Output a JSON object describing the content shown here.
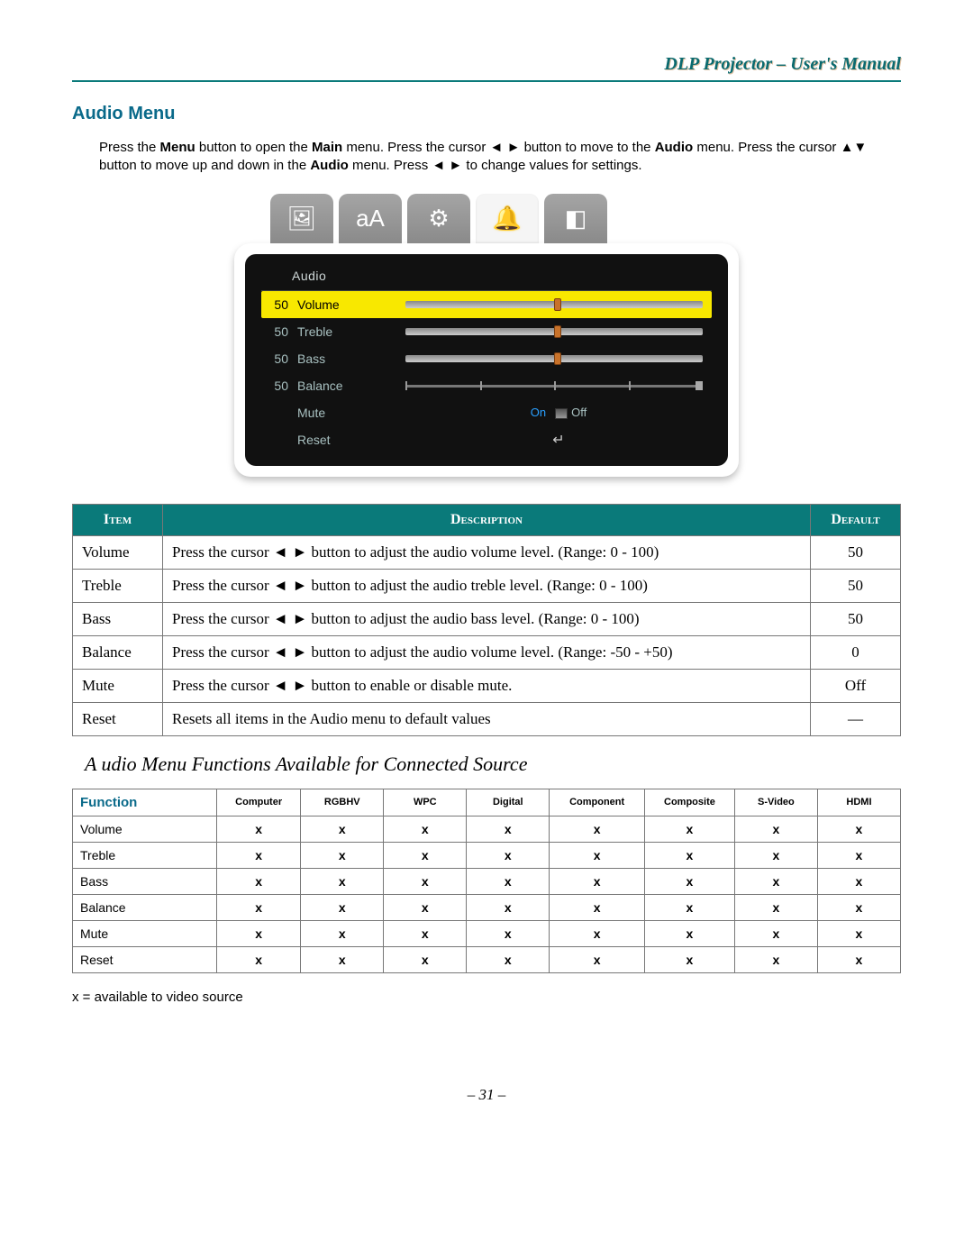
{
  "header": {
    "title": "DLP Projector – User's Manual"
  },
  "section": {
    "title": "Audio Menu"
  },
  "intro": {
    "parts": [
      "Press the ",
      "Menu",
      " button to open the ",
      "Main",
      " menu. Press the cursor ◄ ► button to move to the ",
      "Audio",
      " menu. Press the cursor ▲▼ button to move up and down in the ",
      "Audio",
      " menu. Press ◄ ► to change values for settings."
    ]
  },
  "osd": {
    "title": "Audio",
    "rows": [
      {
        "value": "50",
        "label": "Volume",
        "type": "slider",
        "pos": 50,
        "selected": true
      },
      {
        "value": "50",
        "label": "Treble",
        "type": "slider",
        "pos": 50
      },
      {
        "value": "50",
        "label": "Bass",
        "type": "slider",
        "pos": 50
      },
      {
        "value": "50",
        "label": "Balance",
        "type": "balance"
      },
      {
        "value": "",
        "label": "Mute",
        "type": "toggle",
        "on": "On",
        "off": "Off"
      },
      {
        "value": "",
        "label": "Reset",
        "type": "reset",
        "symbol": "↵"
      }
    ],
    "tab_icons": [
      "🖼",
      "aA",
      "⚙",
      "🔔",
      "◧"
    ]
  },
  "desc_table": {
    "headers": {
      "item": "Item",
      "description": "Description",
      "default": "Default"
    },
    "rows": [
      {
        "item": "Volume",
        "desc_a": "Press the cursor ",
        "desc_b": " button to adjust the audio volume level. (Range: 0 - 100)",
        "default": "50"
      },
      {
        "item": "Treble",
        "desc_a": "Press the cursor ",
        "desc_b": " button to adjust the audio treble level. (Range: 0 - 100)",
        "default": "50"
      },
      {
        "item": "Bass",
        "desc_a": "Press the cursor ",
        "desc_b": " button to adjust the audio bass level. (Range: 0 - 100)",
        "default": "50"
      },
      {
        "item": "Balance",
        "desc_a": "Press the cursor ",
        "desc_b": " button to adjust the audio volume level. (Range: -50 - +50)",
        "default": "0"
      },
      {
        "item": "Mute",
        "desc_a": "Press the cursor ",
        "desc_b": " button to enable or disable mute.",
        "default": "Off"
      },
      {
        "item": "Reset",
        "desc_full": "Resets all items in the Audio menu to default values",
        "default": "—"
      }
    ],
    "arrows": "◄ ►"
  },
  "subheading": "A   udio Menu Functions Available for Connected Source",
  "func_table": {
    "fn_header": "Function",
    "sources": [
      "Computer",
      "RGBHV",
      "WPC",
      "Digital",
      "Component",
      "Composite",
      "S-Video",
      "HDMI"
    ],
    "rows": [
      {
        "fn": "Volume",
        "vals": [
          "x",
          "x",
          "x",
          "x",
          "x",
          "x",
          "x",
          "x"
        ]
      },
      {
        "fn": "Treble",
        "vals": [
          "x",
          "x",
          "x",
          "x",
          "x",
          "x",
          "x",
          "x"
        ]
      },
      {
        "fn": "Bass",
        "vals": [
          "x",
          "x",
          "x",
          "x",
          "x",
          "x",
          "x",
          "x"
        ]
      },
      {
        "fn": "Balance",
        "vals": [
          "x",
          "x",
          "x",
          "x",
          "x",
          "x",
          "x",
          "x"
        ]
      },
      {
        "fn": "Mute",
        "vals": [
          "x",
          "x",
          "x",
          "x",
          "x",
          "x",
          "x",
          "x"
        ]
      },
      {
        "fn": "Reset",
        "vals": [
          "x",
          "x",
          "x",
          "x",
          "x",
          "x",
          "x",
          "x"
        ]
      }
    ]
  },
  "footnote": "x = available to video source",
  "page_number": "– 31 –"
}
